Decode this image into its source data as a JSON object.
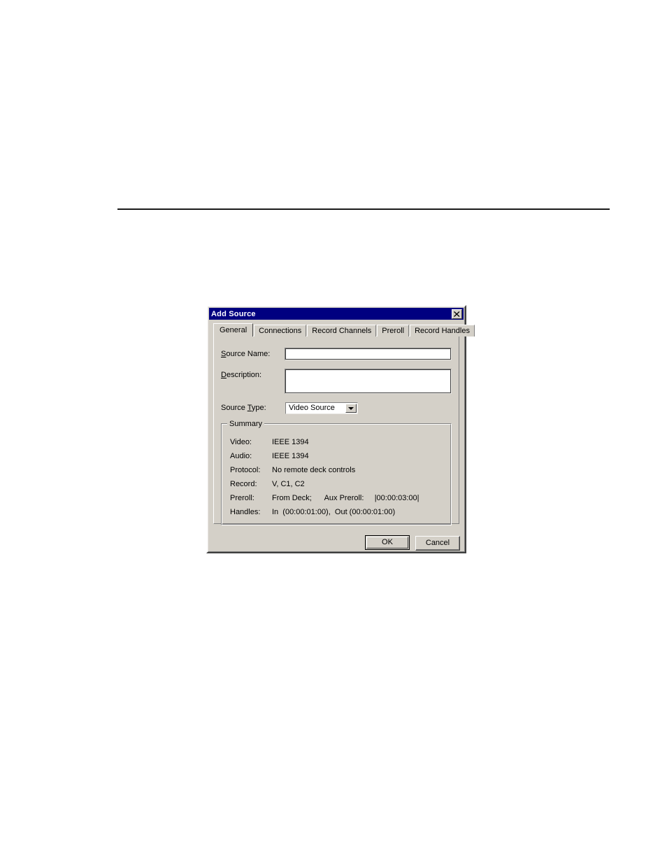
{
  "page": {
    "rule_present": true,
    "background_color": "#ffffff"
  },
  "dialog": {
    "title": "Add Source",
    "titlebar_color": "#000080",
    "face_color": "#d4d0c8",
    "close_icon": "close-icon",
    "tabs": [
      {
        "label": "General",
        "active": true
      },
      {
        "label": "Connections",
        "active": false
      },
      {
        "label": "Record Channels",
        "active": false
      },
      {
        "label": "Preroll",
        "active": false
      },
      {
        "label": "Record Handles",
        "active": false
      }
    ],
    "general_tab": {
      "source_name": {
        "label": "Source Name:",
        "accel": "S",
        "value": "",
        "placeholder": ""
      },
      "description": {
        "label": "Description:",
        "accel": "D",
        "value": "",
        "placeholder": ""
      },
      "source_type": {
        "label": "Source Type:",
        "accel": "T",
        "value": "Video Source",
        "options": [
          "Video Source"
        ]
      },
      "summary": {
        "title": "Summary",
        "rows": [
          {
            "key": "Video:",
            "value": "IEEE 1394"
          },
          {
            "key": "Audio:",
            "value": "IEEE 1394"
          },
          {
            "key": "Protocol:",
            "value": "No remote deck controls"
          },
          {
            "key": "Record:",
            "value": "V, C1, C2"
          },
          {
            "key": "Preroll:",
            "value": "From Deck;      Aux Preroll:     |00:00:03:00|"
          },
          {
            "key": "Handles:",
            "value": "In  (00:00:01:00),  Out (00:00:01:00)"
          }
        ]
      }
    },
    "buttons": {
      "ok": "OK",
      "cancel": "Cancel"
    }
  }
}
